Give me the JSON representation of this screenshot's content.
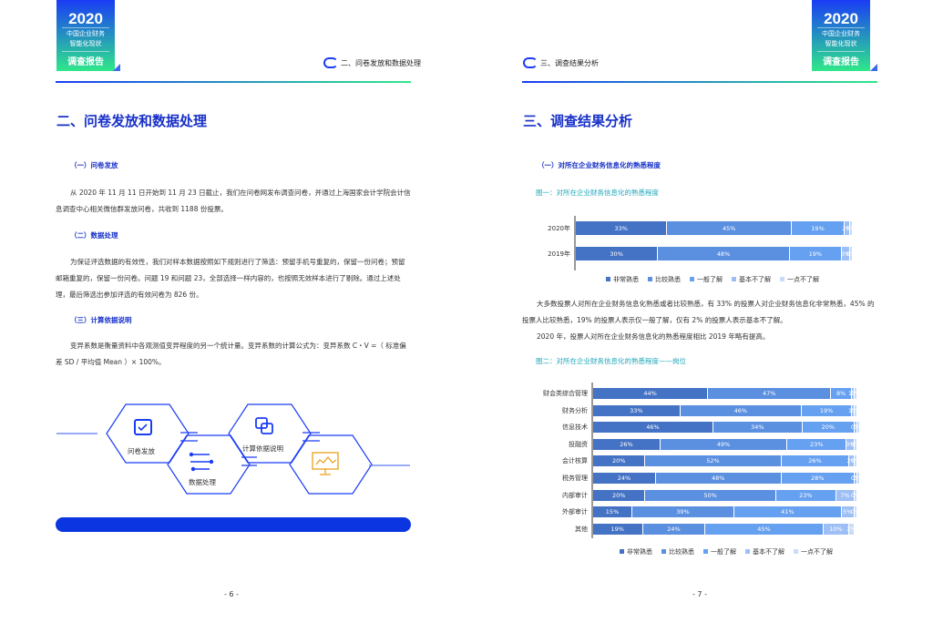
{
  "badge": {
    "year": "2020",
    "line1": "中国企业财务",
    "line2": "智能化现状",
    "report": "调查报告"
  },
  "left": {
    "header": "二、问卷发放和数据处理",
    "title": "二、问卷发放和数据处理",
    "s1": "（一）问卷发放",
    "p1": "从 2020 年 11 月 11 日开始到 11 月 23 日截止，我们在问卷网发布调查问卷，并通过上海国家会计学院会计信息调查中心相关微信群发放问卷，共收到 1188 份投票。",
    "s2": "（二）数据处理",
    "p2": "为保证评选数据的有效性，我们对样本数据按照如下规则进行了筛选：预留手机号重复的，保留一份问卷；预留邮箱重复的，保留一份问卷。问题 19 和问题 23，全部选择一样内容的，也按照无效样本进行了剔除。通过上述处理，最后筛选出参加评选的有效问卷为 826 份。",
    "s3": "（三）计算依据说明",
    "p3": "变异系数是衡量资料中各观测值变异程度的另一个统计量。变异系数的计算公式为：变异系数 C・V =（ 标准偏差 SD / 平均值 Mean ）× 100%。",
    "diagram": [
      "问卷发放",
      "数据处理",
      "计算依据说明"
    ],
    "page": "- 6 -"
  },
  "right": {
    "header": "三、调查结果分析",
    "title": "三、调查结果分析",
    "s1": "（一）对所在企业财务信息化的熟悉程度",
    "fig1": "图一：对所在企业财务信息化的熟悉程度",
    "p1": "大多数投票人对所在企业财务信息化熟悉或者比较熟悉，有 33% 的投票人对企业财务信息化非常熟悉，45% 的投票人比较熟悉，19% 的投票人表示仅一般了解，仅有 2% 的投票人表示基本不了解。",
    "p2": "2020 年，投票人对所在企业财务信息化的熟悉程度相比 2019 年略有提高。",
    "fig2": "图二：对所在企业财务信息化的熟悉程度——岗位",
    "page": "- 7 -"
  },
  "colors": [
    "#4472c4",
    "#5b8fe0",
    "#66a0f0",
    "#9dbff5",
    "#c7dcf8"
  ],
  "chart_data": [
    {
      "type": "bar",
      "stacked": true,
      "orientation": "horizontal",
      "title": "图一：对所在企业财务信息化的熟悉程度",
      "categories": [
        "2020年",
        "2019年"
      ],
      "legend": [
        "非常熟悉",
        "比较熟悉",
        "一般了解",
        "基本不了解",
        "一点不了解"
      ],
      "series_values": [
        [
          33,
          45,
          19,
          2,
          0
        ],
        [
          30,
          48,
          19,
          3,
          0
        ]
      ]
    },
    {
      "type": "bar",
      "stacked": true,
      "orientation": "horizontal",
      "title": "图二：对所在企业财务信息化的熟悉程度——岗位",
      "categories": [
        "财会类综合管理",
        "财务分析",
        "信息技术",
        "投融资",
        "会计核算",
        "税务管理",
        "内部审计",
        "外部审计",
        "其他"
      ],
      "legend": [
        "非常熟悉",
        "比较熟悉",
        "一般了解",
        "基本不了解",
        "一点不了解"
      ],
      "series_values": [
        [
          44,
          47,
          8,
          1,
          0
        ],
        [
          33,
          46,
          19,
          1,
          0
        ],
        [
          46,
          34,
          20,
          0,
          0
        ],
        [
          26,
          49,
          23,
          3,
          0
        ],
        [
          20,
          52,
          26,
          2,
          0
        ],
        [
          24,
          48,
          28,
          0,
          0
        ],
        [
          20,
          50,
          23,
          7,
          0
        ],
        [
          15,
          39,
          41,
          5,
          0
        ],
        [
          19,
          24,
          45,
          10,
          2
        ]
      ]
    }
  ]
}
